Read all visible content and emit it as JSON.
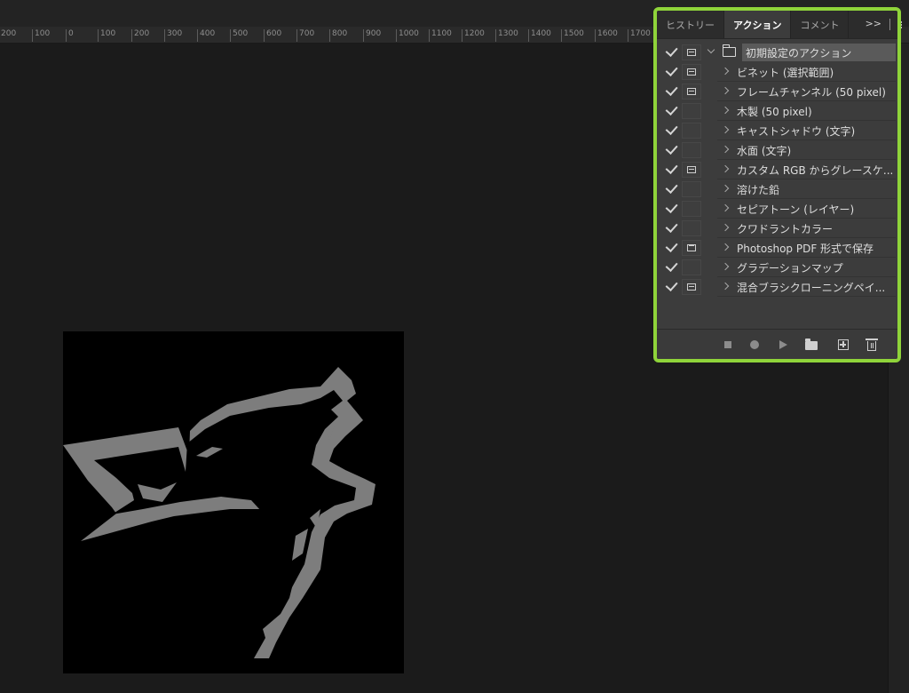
{
  "ruler": {
    "ticks": [
      "200",
      "100",
      "0",
      "100",
      "200",
      "300",
      "400",
      "500",
      "600",
      "700",
      "800",
      "900",
      "1000",
      "1100",
      "1200",
      "1300",
      "1400",
      "1500",
      "1600",
      "1700"
    ]
  },
  "panel": {
    "accent_color": "#8fd43a",
    "tabs": [
      {
        "label": "ヒストリー",
        "active": false
      },
      {
        "label": "アクション",
        "active": true
      },
      {
        "label": "コメント",
        "active": false
      }
    ],
    "more_label": ">>",
    "actions": [
      {
        "label": "初期設定のアクション",
        "checked": true,
        "dialog": "dialog",
        "type": "set"
      },
      {
        "label": "ビネット (選択範囲)",
        "checked": true,
        "dialog": "dialog",
        "type": "action"
      },
      {
        "label": "フレームチャンネル (50 pixel)",
        "checked": true,
        "dialog": "dialog",
        "type": "action"
      },
      {
        "label": "木製 (50 pixel)",
        "checked": true,
        "dialog": "none",
        "type": "action"
      },
      {
        "label": "キャストシャドウ (文字)",
        "checked": true,
        "dialog": "none",
        "type": "action"
      },
      {
        "label": "水面 (文字)",
        "checked": true,
        "dialog": "none",
        "type": "action"
      },
      {
        "label": "カスタム RGB からグレースケ...",
        "checked": true,
        "dialog": "dialog",
        "type": "action"
      },
      {
        "label": "溶けた鉛",
        "checked": true,
        "dialog": "none",
        "type": "action"
      },
      {
        "label": "セピアトーン (レイヤー)",
        "checked": true,
        "dialog": "none",
        "type": "action"
      },
      {
        "label": "クワドラントカラー",
        "checked": true,
        "dialog": "none",
        "type": "action"
      },
      {
        "label": "Photoshop PDF 形式で保存",
        "checked": true,
        "dialog": "window",
        "type": "action"
      },
      {
        "label": "グラデーションマップ",
        "checked": true,
        "dialog": "none",
        "type": "action"
      },
      {
        "label": "混合ブラシクローニングペイ...",
        "checked": true,
        "dialog": "dialog",
        "type": "action"
      }
    ],
    "footer_icons": [
      "stop-icon",
      "record-icon",
      "play-icon",
      "new-set-folder-icon",
      "new-action-icon",
      "trash-icon"
    ]
  },
  "document": {
    "background_color": "#000000",
    "shape_color": "#7d7d7d",
    "icon": "howling-wolf-outline"
  }
}
